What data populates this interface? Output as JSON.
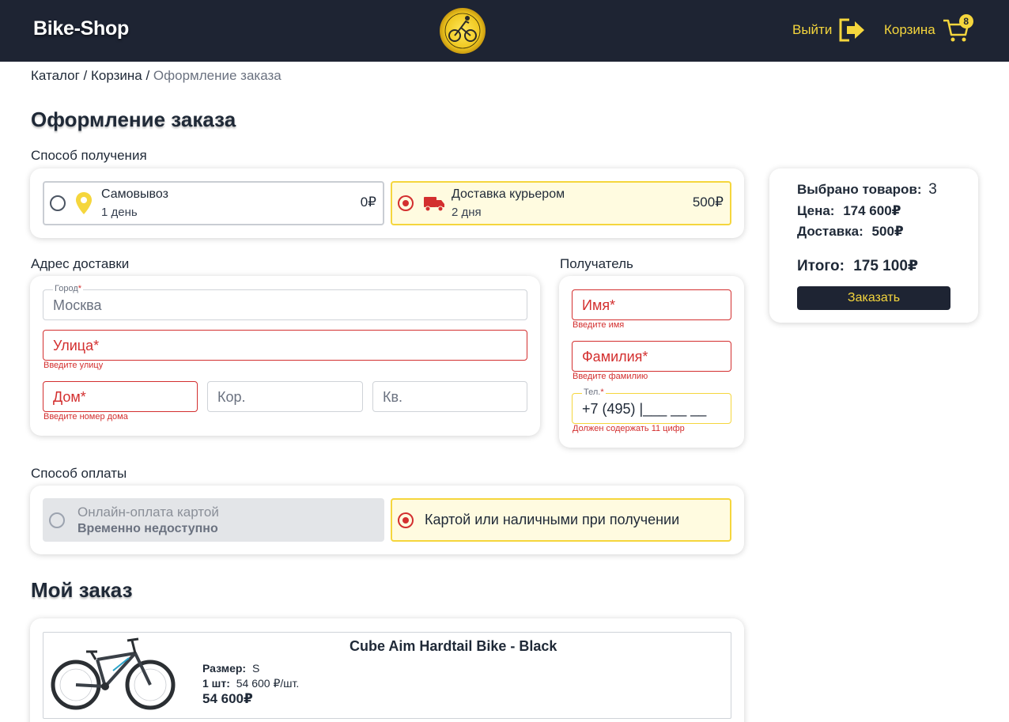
{
  "header": {
    "brand": "Bike-Shop",
    "logout_label": "Выйти",
    "cart_label": "Корзина",
    "cart_count": "8"
  },
  "breadcrumb": {
    "catalog": "Каталог",
    "cart": "Корзина",
    "current": "Оформление заказа",
    "separator": " / "
  },
  "page_title": "Оформление заказа",
  "delivery_method": {
    "label": "Способ получения",
    "options": [
      {
        "title": "Самовывоз",
        "sub": "1 день",
        "price": "0₽",
        "selected": false
      },
      {
        "title": "Доставка курьером",
        "sub": "2 дня",
        "price": "500₽",
        "selected": true
      }
    ]
  },
  "address": {
    "label": "Адрес доставки",
    "city_label": "Город",
    "city_value": "Москва",
    "street_placeholder": "Улица*",
    "street_error": "Введите улицу",
    "house_placeholder": "Дом*",
    "house_error": "Введите номер дома",
    "building_placeholder": "Кор.",
    "apartment_placeholder": "Кв."
  },
  "recipient": {
    "label": "Получатель",
    "name_placeholder": "Имя*",
    "name_error": "Введите имя",
    "surname_placeholder": "Фамилия*",
    "surname_error": "Введите фамилию",
    "phone_label": "Тел.",
    "phone_value": "+7 (495) |___ __ __",
    "phone_error": "Должен содержать 11 цифр"
  },
  "payment": {
    "label": "Способ оплаты",
    "options": [
      {
        "title": "Онлайн-оплата картой",
        "sub": "Временно недоступно",
        "disabled": true
      },
      {
        "title": "Картой или наличными при получении",
        "selected": true
      }
    ]
  },
  "summary": {
    "items_label": "Выбрано товаров:",
    "items_value": "3",
    "price_label": "Цена:",
    "price_value": "174 600₽",
    "delivery_label": "Доставка:",
    "delivery_value": "500₽",
    "total_label": "Итого:",
    "total_value": "175 100₽",
    "order_button": "Заказать"
  },
  "my_order": {
    "title": "Мой заказ",
    "items": [
      {
        "name": "Cube Aim Hardtail Bike - Black",
        "size_label": "Размер:",
        "size_value": "S",
        "qty_label": "1 шт:",
        "unit_price": "54 600 ₽/шт.",
        "total": "54 600₽"
      }
    ]
  },
  "colors": {
    "header_bg": "#1e2433",
    "accent_yellow": "#f5d63d",
    "error_red": "#d32f2f",
    "selected_bg": "#fffbe0"
  }
}
